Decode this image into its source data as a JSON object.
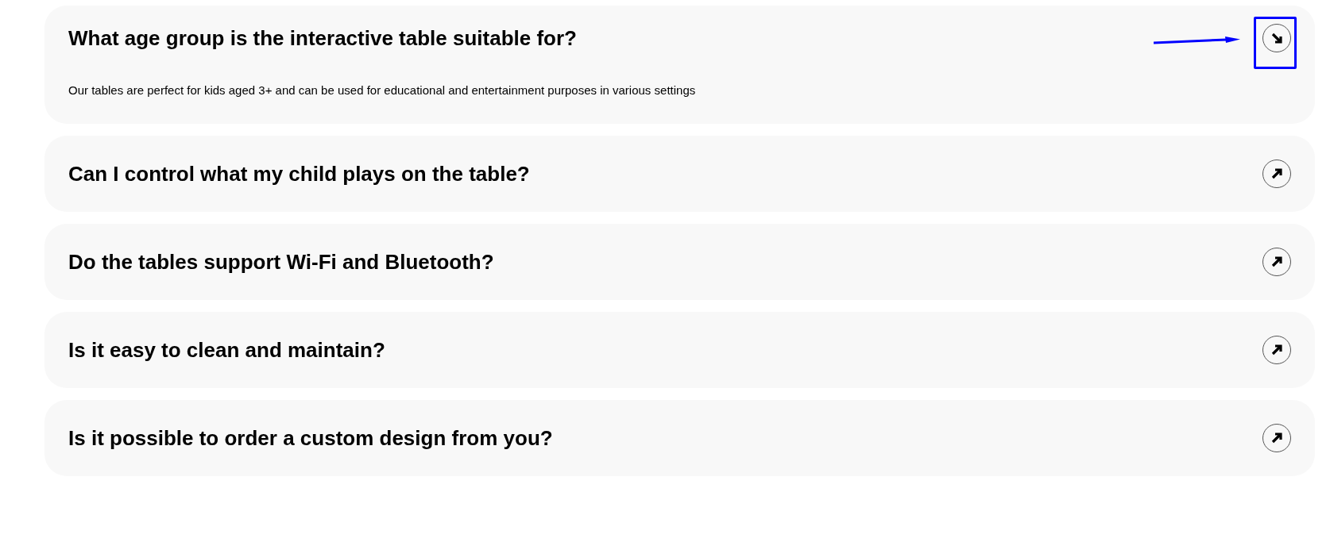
{
  "faq": [
    {
      "question": "What age group is the interactive table suitable for?",
      "answer": "Our tables are perfect for kids aged 3+ and can be used for educational and entertainment purposes in various settings",
      "expanded": true,
      "highlighted": true
    },
    {
      "question": "Can I control what my child plays on the table?",
      "expanded": false,
      "highlighted": false
    },
    {
      "question": "Do the tables support Wi-Fi and Bluetooth?",
      "expanded": false,
      "highlighted": false
    },
    {
      "question": "Is it easy to clean and maintain?",
      "expanded": false,
      "highlighted": false
    },
    {
      "question": "Is it possible to order a custom design from you?",
      "expanded": false,
      "highlighted": false
    }
  ]
}
